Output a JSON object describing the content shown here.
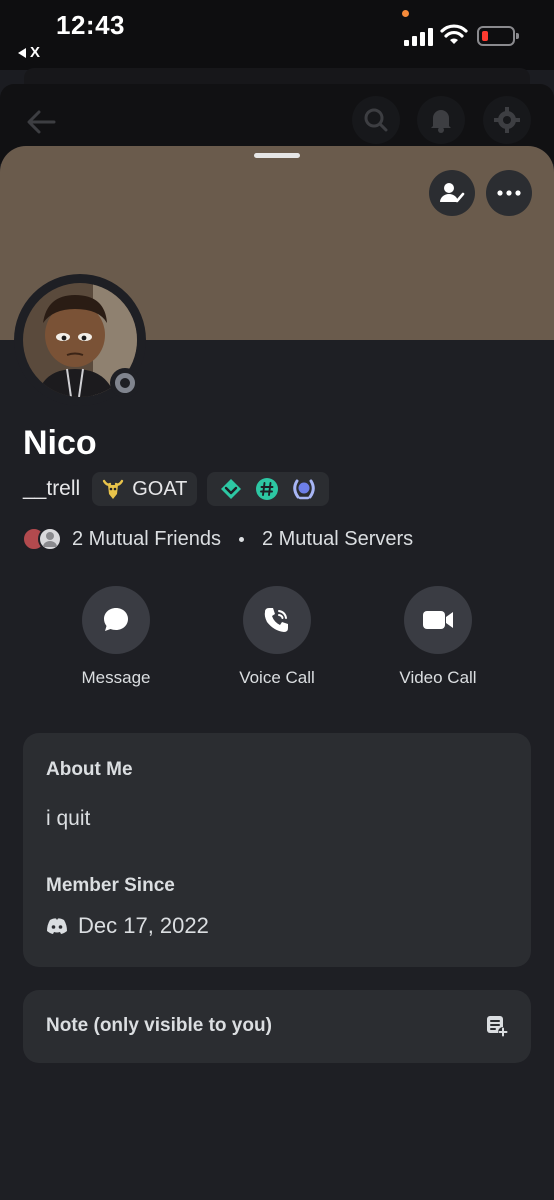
{
  "status_bar": {
    "time": "12:43",
    "back_app": "X"
  },
  "profile": {
    "display_name": "Nico",
    "username": "__trell",
    "clan_tag": "GOAT",
    "mutuals": {
      "friends": "2 Mutual Friends",
      "servers": "2 Mutual Servers"
    }
  },
  "actions": [
    {
      "label": "Message",
      "icon": "chat-bubble-icon"
    },
    {
      "label": "Voice Call",
      "icon": "phone-icon"
    },
    {
      "label": "Video Call",
      "icon": "video-camera-icon"
    }
  ],
  "about": {
    "title": "About Me",
    "text": "i quit",
    "member_since_title": "Member Since",
    "member_since_date": "Dec 17, 2022"
  },
  "note": {
    "label": "Note (only visible to you)"
  },
  "colors": {
    "banner": "#6a5b4c",
    "sheet": "#1e1f24",
    "card": "#2b2d31",
    "battery_low": "#ff3b30",
    "badge_teal": "#2dc7a3"
  }
}
